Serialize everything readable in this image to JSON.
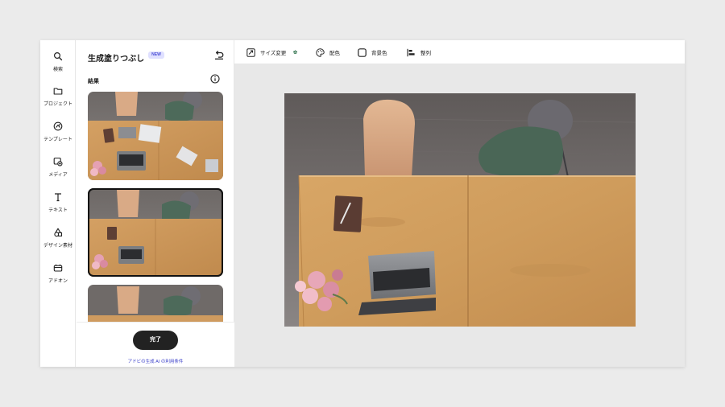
{
  "rail": {
    "items": [
      {
        "label": "検索",
        "icon": "search-icon"
      },
      {
        "label": "プロジェクト",
        "icon": "folder-icon"
      },
      {
        "label": "テンプレート",
        "icon": "template-icon"
      },
      {
        "label": "メディア",
        "icon": "media-icon"
      },
      {
        "label": "テキスト",
        "icon": "text-icon"
      },
      {
        "label": "デザイン素材",
        "icon": "design-assets-icon"
      },
      {
        "label": "アドオン",
        "icon": "addons-icon"
      }
    ]
  },
  "panel": {
    "title": "生成塗りつぶし",
    "badge": "NEW",
    "results_label": "結果",
    "selected_index": 1,
    "done_label": "完了",
    "terms_link": "アドビの生成 AI の利用条件"
  },
  "toolbar": {
    "resize_label": "サイズ変更",
    "color_label": "配色",
    "background_label": "背景色",
    "align_label": "整列"
  },
  "colors": {
    "accent_badge_bg": "#dfe0ff",
    "accent_badge_text": "#4b4fd6",
    "primary_button": "#222222",
    "link": "#3a3fc9",
    "premium_crown": "#3b7a57"
  }
}
